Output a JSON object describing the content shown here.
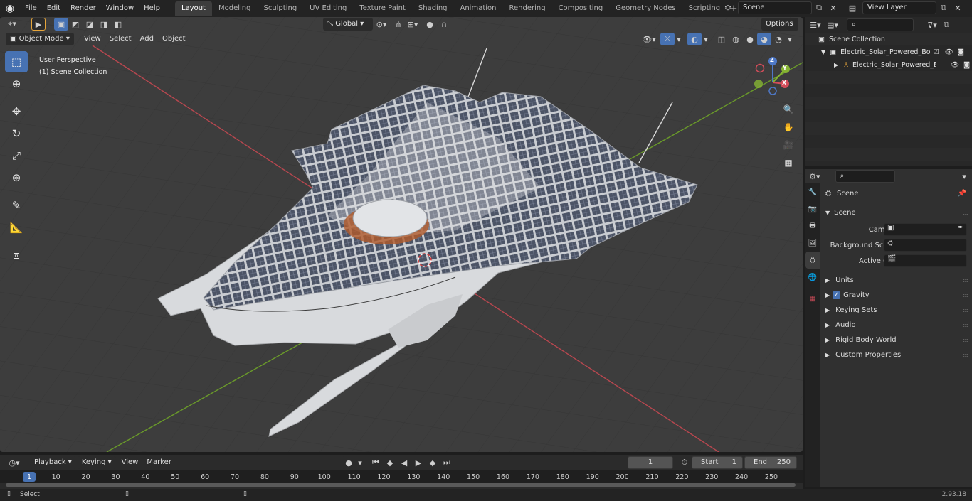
{
  "topbar": {
    "menus": [
      "File",
      "Edit",
      "Render",
      "Window",
      "Help"
    ],
    "workspaces": [
      "Layout",
      "Modeling",
      "Sculpting",
      "UV Editing",
      "Texture Paint",
      "Shading",
      "Animation",
      "Rendering",
      "Compositing",
      "Geometry Nodes",
      "Scripting"
    ],
    "active_workspace": "Layout",
    "scene_name": "Scene",
    "view_layer": "View Layer"
  },
  "viewport": {
    "mode": "Object Mode",
    "menus": [
      "View",
      "Select",
      "Add",
      "Object"
    ],
    "transform_orientation": "Global",
    "options_label": "Options",
    "info_line1": "User Perspective",
    "info_line2": "(1) Scene Collection",
    "gizmo_labels": {
      "z": "Z",
      "y": "Y",
      "x": "X"
    }
  },
  "outliner": {
    "root": "Scene Collection",
    "items": [
      {
        "name": "Electric_Solar_Powered_Boat_",
        "level": 1
      },
      {
        "name": "Electric_Solar_Powered_E",
        "level": 2
      }
    ]
  },
  "properties": {
    "header_title": "Scene",
    "section_scene": "Scene",
    "fields": [
      {
        "label": "Camera"
      },
      {
        "label": "Background Scene"
      },
      {
        "label": "Active Clip"
      }
    ],
    "panels": [
      "Units",
      "Gravity",
      "Keying Sets",
      "Audio",
      "Rigid Body World",
      "Custom Properties"
    ]
  },
  "timeline": {
    "menus": [
      "Playback",
      "Keying",
      "View",
      "Marker"
    ],
    "current_frame": "1",
    "start_label": "Start",
    "start_value": "1",
    "end_label": "End",
    "end_value": "250",
    "ticks": [
      "1",
      "10",
      "20",
      "30",
      "40",
      "50",
      "60",
      "70",
      "80",
      "90",
      "100",
      "110",
      "120",
      "130",
      "140",
      "150",
      "160",
      "170",
      "180",
      "190",
      "200",
      "210",
      "220",
      "230",
      "240",
      "250"
    ]
  },
  "statusbar": {
    "left": "Select",
    "version": "2.93.18"
  },
  "colors": {
    "accent": "#4772b3",
    "axis_x": "#d34d5a",
    "axis_y": "#86b433",
    "axis_z": "#4e78c7",
    "viewport_bg": "#3d3d3d"
  }
}
